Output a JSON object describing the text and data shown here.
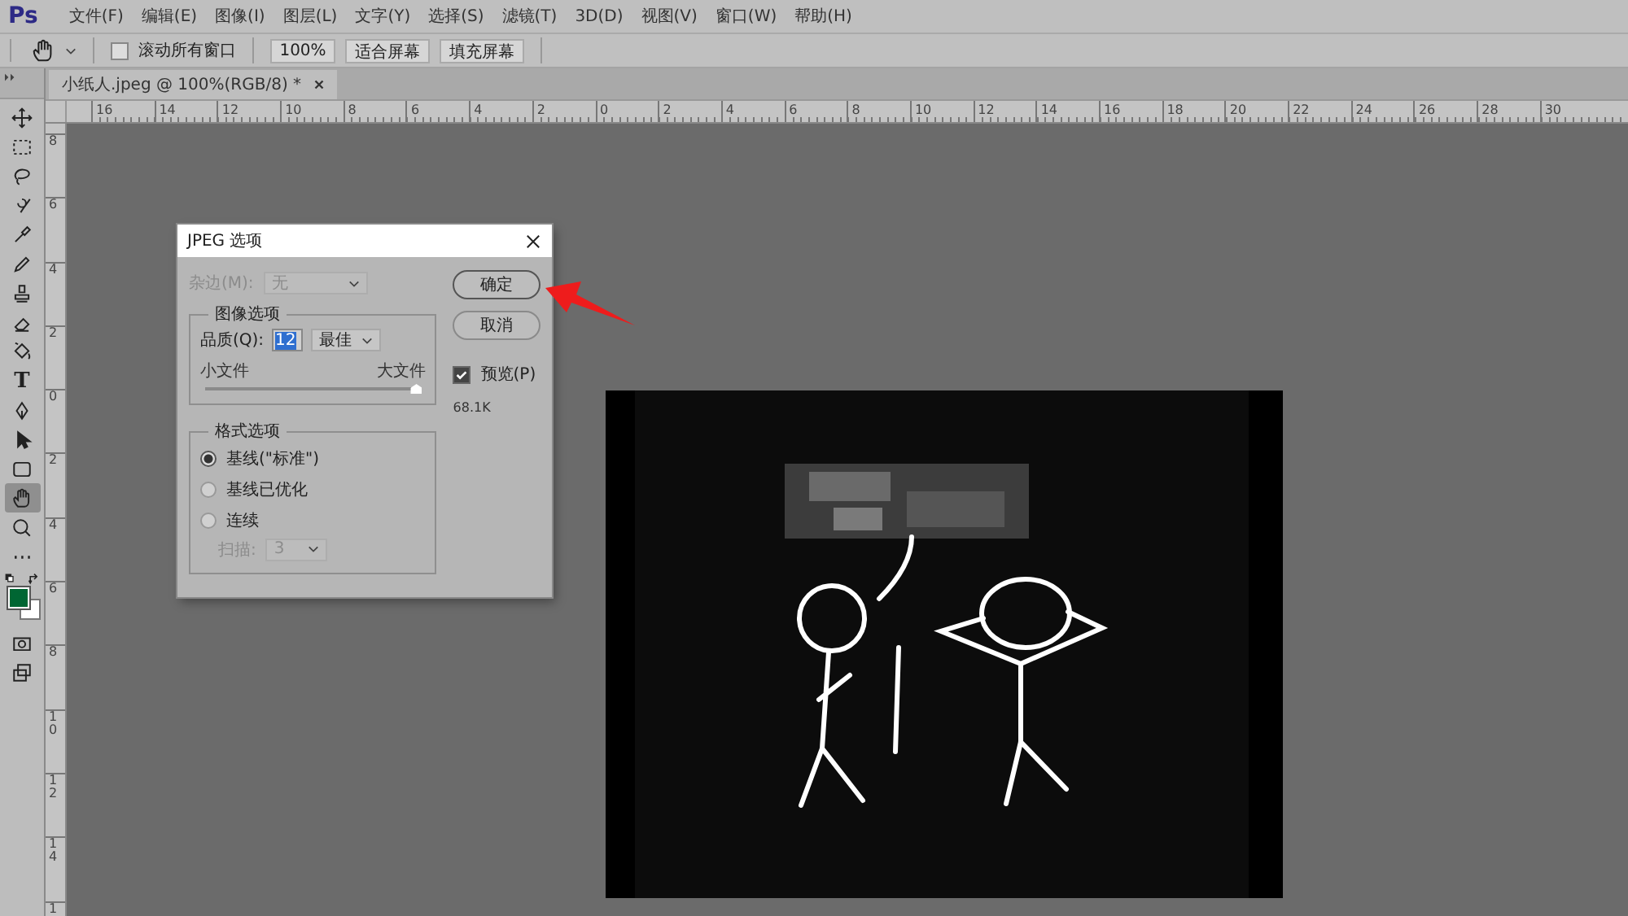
{
  "app": {
    "logo": "Ps"
  },
  "menu": [
    "文件(F)",
    "编辑(E)",
    "图像(I)",
    "图层(L)",
    "文字(Y)",
    "选择(S)",
    "滤镜(T)",
    "3D(D)",
    "视图(V)",
    "窗口(W)",
    "帮助(H)"
  ],
  "options_bar": {
    "scroll_all": {
      "label": "滚动所有窗口",
      "checked": false
    },
    "buttons": [
      "100%",
      "适合屏幕",
      "填充屏幕"
    ]
  },
  "document_tab": {
    "title": "小纸人.jpeg @ 100%(RGB/8) *",
    "selected": true
  },
  "rulers": {
    "horizontal": [
      "16",
      "14",
      "12",
      "10",
      "8",
      "6",
      "4",
      "2",
      "0",
      "2",
      "4",
      "6",
      "8",
      "10",
      "12",
      "14",
      "16",
      "18",
      "20",
      "22",
      "24",
      "26",
      "28",
      "30"
    ],
    "vertical": [
      "8",
      "6",
      "4",
      "2",
      "0",
      "2",
      "4",
      "6",
      "8",
      "10",
      "12",
      "14",
      "1"
    ]
  },
  "tools": [
    {
      "kind": "move",
      "selected": false
    },
    {
      "kind": "marquee",
      "selected": false
    },
    {
      "kind": "lasso",
      "selected": false
    },
    {
      "kind": "quick-select",
      "selected": false
    },
    {
      "kind": "eyedropper",
      "selected": false
    },
    {
      "kind": "brush",
      "selected": false
    },
    {
      "kind": "stamp",
      "selected": false
    },
    {
      "kind": "eraser",
      "selected": false
    },
    {
      "kind": "bucket",
      "selected": false
    },
    {
      "kind": "type",
      "glyph": "T",
      "selected": false
    },
    {
      "kind": "pen",
      "selected": false
    },
    {
      "kind": "path-select",
      "selected": false
    },
    {
      "kind": "shape",
      "selected": false
    },
    {
      "kind": "hand",
      "selected": true
    },
    {
      "kind": "zoom",
      "selected": false
    },
    {
      "kind": "more",
      "selected": false
    }
  ],
  "dialog": {
    "title": "JPEG 选项",
    "matte": {
      "label": "杂边(M):",
      "value": "无",
      "disabled": true
    },
    "image_options": {
      "legend": "图像选项",
      "quality_label": "品质(Q):",
      "quality": "12",
      "quality_preset": "最佳",
      "small_label": "小文件",
      "large_label": "大文件",
      "level": 1.0
    },
    "format_options": {
      "legend": "格式选项",
      "options": [
        {
          "label": "基线(\"标准\")",
          "selected": true
        },
        {
          "label": "基线已优化",
          "selected": false
        },
        {
          "label": "连续",
          "selected": false
        }
      ],
      "scans": {
        "label": "扫描:",
        "value": "3",
        "disabled": true
      }
    },
    "buttons": [
      {
        "label": "确定",
        "default": true
      },
      {
        "label": "取消",
        "default": false
      }
    ],
    "preview": {
      "label": "预览(P)",
      "checked": true
    },
    "size": "68.1K"
  }
}
